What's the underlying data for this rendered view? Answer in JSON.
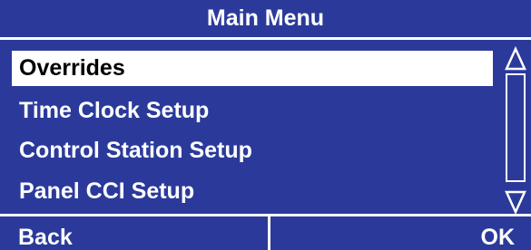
{
  "title": "Main Menu",
  "menu": {
    "items": [
      {
        "label": "Overrides",
        "selected": true
      },
      {
        "label": "Time Clock Setup",
        "selected": false
      },
      {
        "label": "Control Station Setup",
        "selected": false
      },
      {
        "label": "Panel CCI Setup",
        "selected": false
      }
    ]
  },
  "softkeys": {
    "back_label": "Back",
    "ok_label": "OK"
  },
  "icons": {
    "scroll_up": "scroll-up-arrow-icon",
    "scroll_down": "scroll-down-arrow-icon"
  },
  "colors": {
    "background": "#2b3a9a",
    "foreground": "#ffffff",
    "selected_text": "#000000"
  }
}
